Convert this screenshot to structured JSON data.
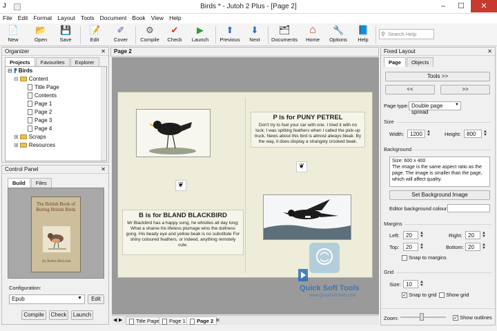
{
  "window": {
    "title": "Birds * - Jutoh 2 Plus - [Page 2]",
    "min": "–",
    "max": "☐",
    "close": "✕",
    "app_icon": "J"
  },
  "menu": [
    "File",
    "Edit",
    "Format",
    "Layout",
    "Tools",
    "Document",
    "Book",
    "View",
    "Help"
  ],
  "toolbar": {
    "items": [
      {
        "label": "New",
        "icon": "new-document-icon",
        "glyph": "📄"
      },
      {
        "label": "Open",
        "icon": "open-folder-icon",
        "glyph": "📂"
      },
      {
        "label": "Save",
        "icon": "save-disk-icon",
        "glyph": "💾"
      },
      {
        "label": "Edit",
        "icon": "edit-page-icon",
        "glyph": "📝"
      },
      {
        "label": "Cover",
        "icon": "cover-icon",
        "glyph": "✐"
      },
      {
        "label": "Compile",
        "icon": "compile-gear-icon",
        "glyph": "⚙"
      },
      {
        "label": "Check",
        "icon": "check-mark-icon",
        "glyph": "✔"
      },
      {
        "label": "Launch",
        "icon": "launch-play-icon",
        "glyph": "▶"
      },
      {
        "label": "Previous",
        "icon": "previous-arrow-icon",
        "glyph": "⬆"
      },
      {
        "label": "Next",
        "icon": "next-arrow-icon",
        "glyph": "⬇"
      },
      {
        "label": "Documents",
        "icon": "documents-icon",
        "glyph": "🗂"
      },
      {
        "label": "Home",
        "icon": "home-icon",
        "glyph": "⌂"
      },
      {
        "label": "Options",
        "icon": "options-wrench-icon",
        "glyph": "🔧"
      },
      {
        "label": "Help",
        "icon": "help-book-icon",
        "glyph": "📘"
      }
    ],
    "search_placeholder": "Search Help"
  },
  "organizer": {
    "title": "Organizer",
    "tabs": [
      "Projects",
      "Favourites",
      "Explorer"
    ],
    "tree": {
      "root": "Birds",
      "content": "Content",
      "pages": [
        "Title Page",
        "Contents",
        "Page 1",
        "Page 2",
        "Page 3",
        "Page 4"
      ],
      "scraps": "Scraps",
      "resources": "Resources"
    }
  },
  "control_panel": {
    "title": "Control Panel",
    "tabs": [
      "Build",
      "Files"
    ],
    "cover_title": "The British Book of Boring British Birds",
    "cover_author": "by Robin McLeish",
    "configuration_label": "Configuration:",
    "configuration_value": "Epub",
    "edit_button": "Edit",
    "buttons": [
      "Compile",
      "Check",
      "Launch"
    ]
  },
  "editor": {
    "tab_title": "Page 2",
    "right_heading": "P is for PUNY PETREL",
    "right_body": "Don't try to fuel your car with one. I tried it with no luck; I was spitting feathers when I called the pick-up truck. News about this bird is almost always bleak. By the way, it does display a strangely crooked beak.",
    "left_heading": "B is for BLAND BLACKBIRD",
    "left_body": "Mr Blackbird has a happy song, he whistles all day long; What a shame his lifeless plumage wins the dullness gong. His beady eye and yellow beak is no substitute For shiny coloured feathers, or indeed, anything remotely cute.",
    "doc_tabs": [
      "Title Page",
      "Page 1",
      "Page 2"
    ]
  },
  "fixed_layout": {
    "title": "Fixed Layout",
    "tabs": [
      "Page",
      "Objects"
    ],
    "tools_button": "Tools >>",
    "prev_button": "<<",
    "next_button": ">>",
    "page_type_label": "Page type:",
    "page_type_value": "Double page spread",
    "size_section": "Size",
    "width_label": "Width:",
    "width_value": "1200",
    "height_label": "Height:",
    "height_value": "800",
    "background_section": "Background",
    "background_info": "Size: 600 x 400\nThe image is the same aspect ratio as the page. The image is smaller than the page, which will affect quality.",
    "set_background_button": "Set Background Image",
    "editor_bg_label": "Editor background colour:",
    "margins_section": "Margins",
    "left_label": "Left:",
    "left_value": "20",
    "right_label": "Right:",
    "right_value": "20",
    "top_label": "Top:",
    "top_value": "20",
    "bottom_label": "Bottom:",
    "bottom_value": "20",
    "snap_margins": "Snap to margins",
    "grid_section": "Grid",
    "grid_size_label": "Size:",
    "grid_size_value": "10",
    "snap_grid": "Snap to grid",
    "show_grid": "Show grid",
    "zoom_label": "Zoom:",
    "show_outlines": "Show outlines"
  },
  "watermark": {
    "line1": "Quick Soft Tools",
    "line2": "www.QuickSoftTools.com"
  },
  "colors": {
    "accent": "#1d4f8c",
    "page_bg": "#eeedd9",
    "canvas_bg": "#9a9a9a",
    "close_red": "#c83a2d"
  }
}
